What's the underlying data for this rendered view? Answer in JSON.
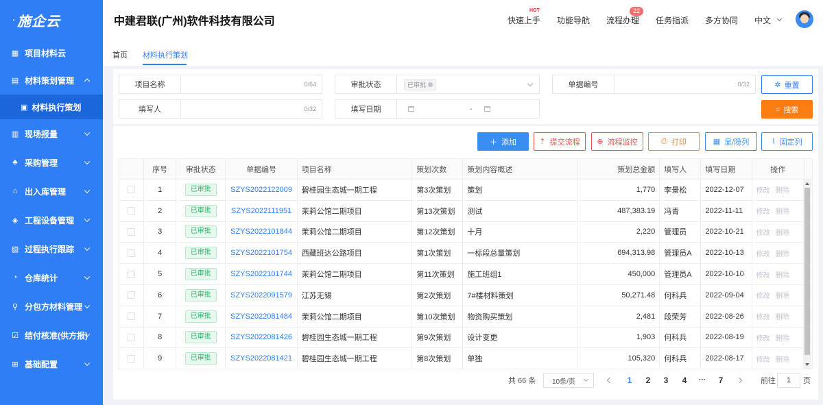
{
  "brand": {
    "logo_text": "施企云"
  },
  "sidebar": {
    "items": [
      {
        "label": "项目材料云",
        "icon": "grid-icon"
      },
      {
        "label": "材料策划管理",
        "icon": "document-icon",
        "expanded": true
      },
      {
        "label": "材料执行策划",
        "icon": "file-stack-icon",
        "sub": true
      },
      {
        "label": "现场报量",
        "icon": "chart-screen-icon"
      },
      {
        "label": "采购管理",
        "icon": "org-icon"
      },
      {
        "label": "出入库管理",
        "icon": "warehouse-icon"
      },
      {
        "label": "工程设备管理",
        "icon": "cube-icon"
      },
      {
        "label": "过程执行跟踪",
        "icon": "track-icon"
      },
      {
        "label": "仓库统计",
        "icon": "pie-icon"
      },
      {
        "label": "分包方材料管理",
        "icon": "share-icon"
      },
      {
        "label": "结付核准(供方报)",
        "icon": "checklist-icon"
      },
      {
        "label": "基础配置",
        "icon": "settings-grid-icon"
      }
    ]
  },
  "header": {
    "company": "中建君联(广州)软件科技有限公司",
    "nav": [
      {
        "label": "快速上手",
        "hot": "HOT"
      },
      {
        "label": "功能导航"
      },
      {
        "label": "流程办理",
        "badge": "22"
      },
      {
        "label": "任务指派"
      },
      {
        "label": "多方协同"
      }
    ],
    "language": "中文"
  },
  "tabs": [
    {
      "label": "首页"
    },
    {
      "label": "材料执行策划",
      "active": true
    }
  ],
  "search": {
    "project_name": {
      "label": "项目名称",
      "count": "0/64"
    },
    "approval_status": {
      "label": "审批状态",
      "tag": "已审批"
    },
    "doc_no": {
      "label": "单据编号",
      "count": "0/32"
    },
    "filler": {
      "label": "填写人",
      "count": "0/32"
    },
    "fill_date": {
      "label": "填写日期",
      "separator": "-"
    },
    "reset_label": "重置",
    "search_label": "搜索"
  },
  "toolbar": {
    "add": "添加",
    "submit": "提交流程",
    "monitor": "流程监控",
    "print": "打印",
    "columns": "显/隐列",
    "pin": "固定列"
  },
  "table": {
    "headers": [
      "序号",
      "审批状态",
      "单据编号",
      "项目名称",
      "策划次数",
      "策划内容概述",
      "策划总金额",
      "填写人",
      "填写日期",
      "操作"
    ],
    "rows": [
      {
        "no": "1",
        "status": "已审批",
        "doc": "SZYS2022122009",
        "project": "碧桂园生态城一期工程",
        "times": "第3次策划",
        "summary": "策划",
        "amount": "1,770",
        "filler": "李景松",
        "date": "2022-12-07"
      },
      {
        "no": "2",
        "status": "已审批",
        "doc": "SZYS2022111951",
        "project": "茉莉公馆二期项目",
        "times": "第13次策划",
        "summary": "测试",
        "amount": "487,383.19",
        "filler": "冯青",
        "date": "2022-11-11"
      },
      {
        "no": "3",
        "status": "已审批",
        "doc": "SZYS2022101844",
        "project": "茉莉公馆二期项目",
        "times": "第12次策划",
        "summary": "十月",
        "amount": "2,220",
        "filler": "管理员",
        "date": "2022-10-21"
      },
      {
        "no": "4",
        "status": "已审批",
        "doc": "SZYS2022101754",
        "project": "西藏班达公路项目",
        "times": "第1次策划",
        "summary": "一标段总量策划",
        "amount": "694,313.98",
        "filler": "管理员A",
        "date": "2022-10-13"
      },
      {
        "no": "5",
        "status": "已审批",
        "doc": "SZYS2022101744",
        "project": "茉莉公馆二期项目",
        "times": "第11次策划",
        "summary": "施工班组1",
        "amount": "450,000",
        "filler": "管理员A",
        "date": "2022-10-10"
      },
      {
        "no": "6",
        "status": "已审批",
        "doc": "SZYS2022091579",
        "project": "江苏无锡",
        "times": "第2次策划",
        "summary": "7#楼材料策划",
        "amount": "50,271.48",
        "filler": "何科兵",
        "date": "2022-09-04"
      },
      {
        "no": "7",
        "status": "已审批",
        "doc": "SZYS2022081484",
        "project": "茉莉公馆二期项目",
        "times": "第10次策划",
        "summary": "物资购买策划",
        "amount": "2,481",
        "filler": "段荣芳",
        "date": "2022-08-26"
      },
      {
        "no": "8",
        "status": "已审批",
        "doc": "SZYS2022081426",
        "project": "碧桂园生态城一期工程",
        "times": "第9次策划",
        "summary": "设计变更",
        "amount": "1,903",
        "filler": "何科兵",
        "date": "2022-08-19"
      },
      {
        "no": "9",
        "status": "已审批",
        "doc": "SZYS2022081421",
        "project": "碧桂园生态城一期工程",
        "times": "第8次策划",
        "summary": "单独",
        "amount": "105,320",
        "filler": "何科兵",
        "date": "2022-08-17"
      }
    ],
    "op_edit": "修改",
    "op_delete": "删除"
  },
  "pagination": {
    "total": "共 66 条",
    "page_size": "10条/页",
    "pages": [
      "1",
      "2",
      "3",
      "4",
      "7"
    ],
    "ellipsis": "···",
    "current": "1",
    "goto_prefix": "前往",
    "goto_value": "1",
    "goto_suffix": "页"
  },
  "colors": {
    "primary": "#2f7ef6",
    "sidebar": "#2f7ef6",
    "search_button": "#fa7d14",
    "status_green": "#2db36b"
  }
}
